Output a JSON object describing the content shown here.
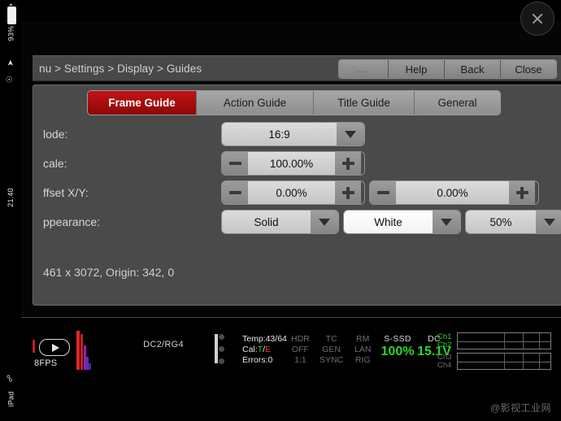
{
  "device": {
    "battery_percent": "93%",
    "clock": "21:40",
    "device_name": "iPad",
    "location_icon": "location-arrow-icon",
    "orientation_lock_icon": "orientation-lock-icon",
    "bluetooth_icon": "bluetooth-icon"
  },
  "overlay": {
    "close_icon": "close-x-icon"
  },
  "menubar": {
    "breadcrumb": "nu > Settings > Display > Guides",
    "buttons": [
      {
        "label": "...",
        "name": "more-button"
      },
      {
        "label": "Help",
        "name": "help-button"
      },
      {
        "label": "Back",
        "name": "back-button"
      },
      {
        "label": "Close",
        "name": "close-button"
      }
    ]
  },
  "tabs": [
    {
      "label": "Frame Guide",
      "active": true
    },
    {
      "label": "Action Guide",
      "active": false
    },
    {
      "label": "Title Guide",
      "active": false
    },
    {
      "label": "General",
      "active": false
    }
  ],
  "form": {
    "mode": {
      "label": "lode:",
      "value": "16:9"
    },
    "scale": {
      "label": "cale:",
      "value": "100.00%",
      "minus": "−",
      "plus": "+"
    },
    "offset": {
      "label": "ffset X/Y:",
      "x_value": "0.00%",
      "y_value": "0.00%"
    },
    "appearance": {
      "label": "ppearance:",
      "style": "Solid",
      "color": "White",
      "opacity": "50%"
    }
  },
  "info": {
    "resolution_origin": "461 x 3072, Origin: 342, 0"
  },
  "status": {
    "playback_icon": "play-icon",
    "fps": "8FPS",
    "media": "DC2/RG4",
    "temp": "Temp:43/64",
    "cal_prefix": "Cal:",
    "cal_t": "T",
    "cal_slash": "/",
    "cal_e": "E",
    "errors": "Errors:0",
    "hdr": "HDR",
    "hdr_state": "OFF",
    "hdr_ratio": "1:1",
    "tc": "TC",
    "tc_gen": "GEN",
    "tc_sync": "SYNC",
    "rm": "RM",
    "rm_lan": "LAN",
    "rm_rig": "RIG",
    "ssd_label": "S-SSD",
    "ssd_value": "100%",
    "dc_label": "DC",
    "dc_value": "15.1V",
    "channels": [
      {
        "label": "Ch1",
        "active": true
      },
      {
        "label": "Ch2",
        "active": true
      },
      {
        "label": "Ch3",
        "active": false
      },
      {
        "label": "Ch4",
        "active": false
      }
    ]
  },
  "watermark": "@影视工业网",
  "colors": {
    "accent_red": "#c11414",
    "status_green": "#2ad62a",
    "panel_gray": "#4a4a4a",
    "field_gray": "#dcdcdc"
  }
}
